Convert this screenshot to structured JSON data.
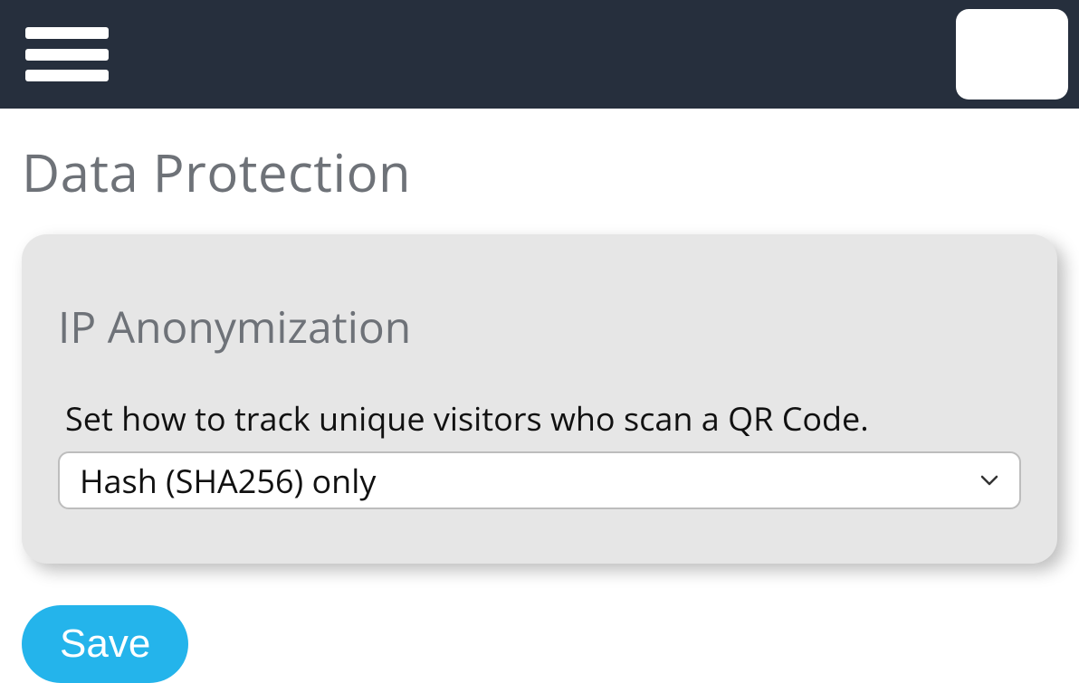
{
  "header": {
    "menu_icon": "hamburger-icon"
  },
  "page": {
    "title": "Data Protection"
  },
  "card": {
    "title": "IP Anonymization",
    "field_label": "Set how to track unique visitors who scan a QR Code.",
    "select_value": "Hash (SHA256) only"
  },
  "actions": {
    "save_label": "Save"
  }
}
